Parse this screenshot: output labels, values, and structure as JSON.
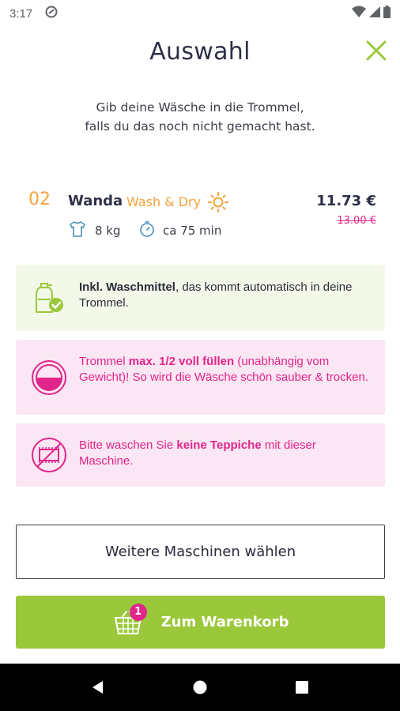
{
  "status_bar": {
    "time": "3:17"
  },
  "header": {
    "title": "Auswahl"
  },
  "intro": {
    "line1": "Gib deine Wäsche in die Trommel,",
    "line2": "falls du das noch nicht gemacht hast."
  },
  "machine": {
    "number": "02",
    "name": "Wanda",
    "program": "Wash & Dry",
    "price": "11.73 €",
    "old_price": "13.00 €",
    "weight": "8 kg",
    "duration": "ca 75 min"
  },
  "info": {
    "detergent": {
      "bold": "Inkl. Waschmittel",
      "text": ", das kommt automatisch in deine Trommel."
    },
    "fill": {
      "pre": "Trommel ",
      "bold": "max. 1/2 voll füllen",
      "post": " (unabhängig vom Gewicht)! So wird die Wäsche schön sauber & trocken."
    },
    "carpet": {
      "pre": "Bitte waschen Sie ",
      "bold": "keine Teppiche",
      "post": " mit dieser Maschine."
    }
  },
  "buttons": {
    "more_machines": "Weitere Maschinen wählen",
    "cart": "Zum Warenkorb",
    "cart_count": "1"
  },
  "colors": {
    "accent_green": "#9bc83b",
    "accent_orange": "#f5a23c",
    "accent_pink": "#e0268a"
  }
}
